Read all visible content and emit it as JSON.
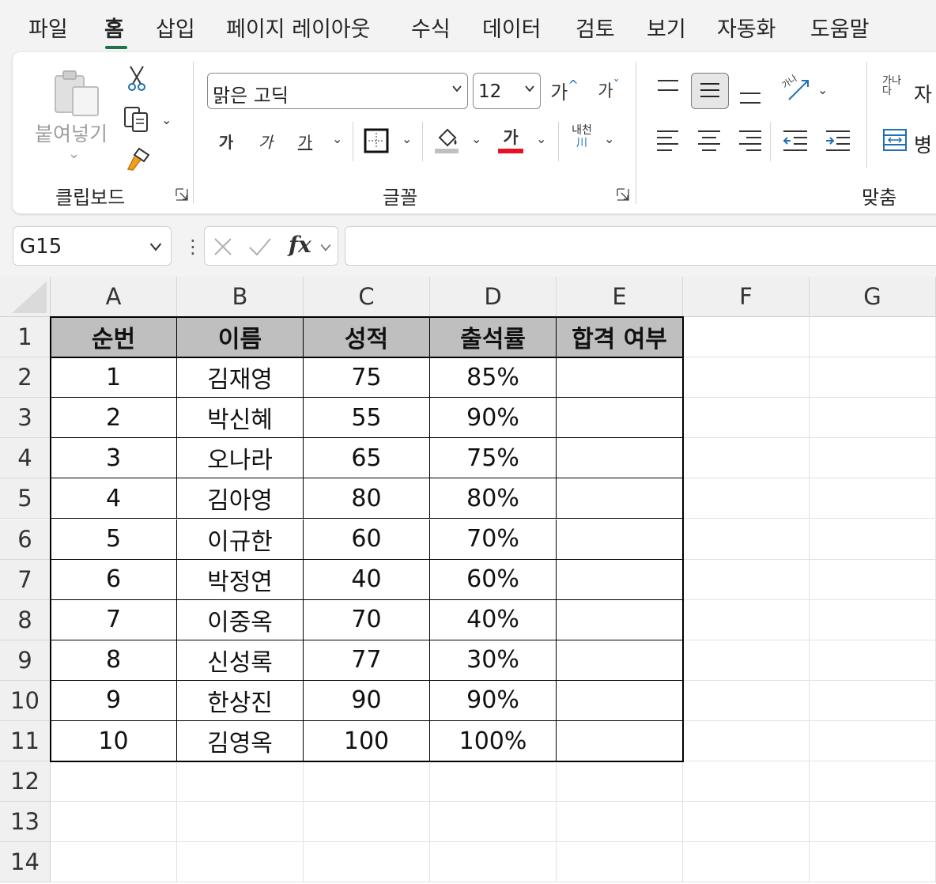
{
  "menu": {
    "tabs": [
      {
        "label": "파일",
        "active": false
      },
      {
        "label": "홈",
        "active": true
      },
      {
        "label": "삽입",
        "active": false
      },
      {
        "label": "페이지 레이아웃",
        "active": false
      },
      {
        "label": "수식",
        "active": false
      },
      {
        "label": "데이터",
        "active": false
      },
      {
        "label": "검토",
        "active": false
      },
      {
        "label": "보기",
        "active": false
      },
      {
        "label": "자동화",
        "active": false
      },
      {
        "label": "도움말",
        "active": false
      }
    ]
  },
  "ribbon": {
    "clipboard": {
      "group_label": "클립보드",
      "paste_label": "붙여넣기"
    },
    "font": {
      "group_label": "글꼴",
      "font_name": "맑은 고딕",
      "font_size": "12",
      "grow_label": "가",
      "shrink_label": "가",
      "bold_label": "가",
      "italic_label": "가",
      "underline_label": "가",
      "font_color_label": "가",
      "phonetic_label_top": "내천",
      "phonetic_label_bottom": "川",
      "font_color": "#e81123",
      "fill_color": "#bfbfbf"
    },
    "alignment": {
      "group_label": "맞춤",
      "wrap_icon_text": "가나\n다",
      "wrap_label": "자",
      "merge_label": "병"
    }
  },
  "formula_bar": {
    "name_box": "G15",
    "fx_label": "fx",
    "formula": ""
  },
  "sheet": {
    "columns": [
      "A",
      "B",
      "C",
      "D",
      "E",
      "F",
      "G"
    ],
    "rows": [
      "1",
      "2",
      "3",
      "4",
      "5",
      "6",
      "7",
      "8",
      "9",
      "10",
      "11",
      "12",
      "13",
      "14"
    ],
    "table_header": [
      "순번",
      "이름",
      "성적",
      "출석률",
      "합격 여부"
    ],
    "table_rows": [
      [
        "1",
        "김재영",
        "75",
        "85%",
        ""
      ],
      [
        "2",
        "박신혜",
        "55",
        "90%",
        ""
      ],
      [
        "3",
        "오나라",
        "65",
        "75%",
        ""
      ],
      [
        "4",
        "김아영",
        "80",
        "80%",
        ""
      ],
      [
        "5",
        "이규한",
        "60",
        "70%",
        ""
      ],
      [
        "6",
        "박정연",
        "40",
        "60%",
        ""
      ],
      [
        "7",
        "이중옥",
        "70",
        "40%",
        ""
      ],
      [
        "8",
        "신성록",
        "77",
        "30%",
        ""
      ],
      [
        "9",
        "한상진",
        "90",
        "90%",
        ""
      ],
      [
        "10",
        "김영옥",
        "100",
        "100%",
        ""
      ]
    ],
    "header_fill": "#bfbfbf",
    "selected_cell": "G15"
  }
}
